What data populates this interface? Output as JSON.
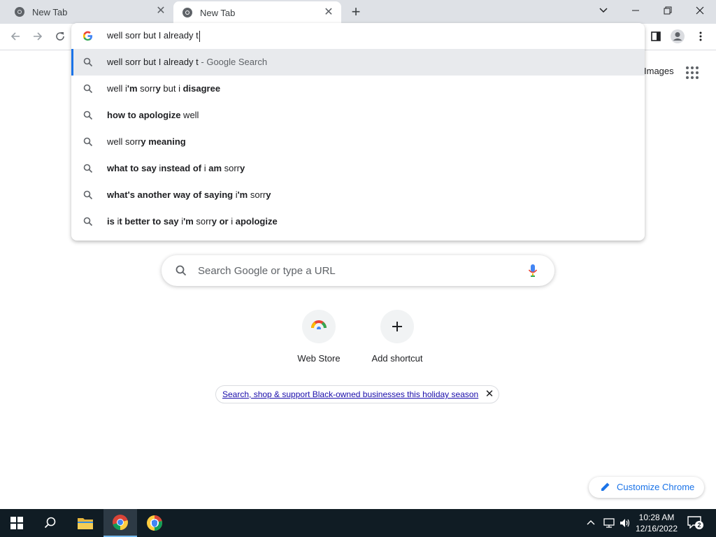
{
  "tabs": [
    {
      "title": "New Tab",
      "active": false
    },
    {
      "title": "New Tab",
      "active": true
    }
  ],
  "omnibox": {
    "input_value": "well sorr but I already t",
    "suggestions": [
      {
        "parts": [
          {
            "t": "well sorr but I already t",
            "b": false
          }
        ],
        "hint": " - Google Search",
        "selected": true
      },
      {
        "parts": [
          {
            "t": "well i",
            "b": false
          },
          {
            "t": "'m",
            "b": true
          },
          {
            "t": " sorr",
            "b": false
          },
          {
            "t": "y",
            "b": true
          },
          {
            "t": " but i ",
            "b": false
          },
          {
            "t": "disagree",
            "b": true
          }
        ],
        "hint": "",
        "selected": false
      },
      {
        "parts": [
          {
            "t": "how to apologize",
            "b": true
          },
          {
            "t": " well",
            "b": false
          }
        ],
        "hint": "",
        "selected": false
      },
      {
        "parts": [
          {
            "t": "well sorr",
            "b": false
          },
          {
            "t": "y meaning",
            "b": true
          }
        ],
        "hint": "",
        "selected": false
      },
      {
        "parts": [
          {
            "t": "what to say ",
            "b": true
          },
          {
            "t": "i",
            "b": false
          },
          {
            "t": "nstead of ",
            "b": true
          },
          {
            "t": "i ",
            "b": false
          },
          {
            "t": "am",
            "b": true
          },
          {
            "t": " sorr",
            "b": false
          },
          {
            "t": "y",
            "b": true
          }
        ],
        "hint": "",
        "selected": false
      },
      {
        "parts": [
          {
            "t": "what's another way of saying ",
            "b": true
          },
          {
            "t": "i",
            "b": false
          },
          {
            "t": "'m",
            "b": true
          },
          {
            "t": " sorr",
            "b": false
          },
          {
            "t": "y",
            "b": true
          }
        ],
        "hint": "",
        "selected": false
      },
      {
        "parts": [
          {
            "t": "is ",
            "b": true
          },
          {
            "t": "i",
            "b": false
          },
          {
            "t": "t better to say ",
            "b": true
          },
          {
            "t": "i",
            "b": false
          },
          {
            "t": "'m",
            "b": true
          },
          {
            "t": " sorr",
            "b": false
          },
          {
            "t": "y or ",
            "b": true
          },
          {
            "t": "i ",
            "b": false
          },
          {
            "t": "apologize",
            "b": true
          }
        ],
        "hint": "",
        "selected": false
      }
    ]
  },
  "page": {
    "images_link": "Images",
    "search_placeholder": "Search Google or type a URL",
    "shortcuts": [
      {
        "label": "Web Store"
      },
      {
        "label": "Add shortcut"
      }
    ],
    "promo_text": "Search, shop & support Black-owned businesses this holiday season",
    "customize_label": "Customize Chrome"
  },
  "taskbar": {
    "time": "10:28 AM",
    "date": "12/16/2022",
    "notification_count": "2"
  },
  "colors": {
    "accent": "#1a73e8",
    "tabstrip": "#dee1e6",
    "taskbar": "#101c24"
  }
}
